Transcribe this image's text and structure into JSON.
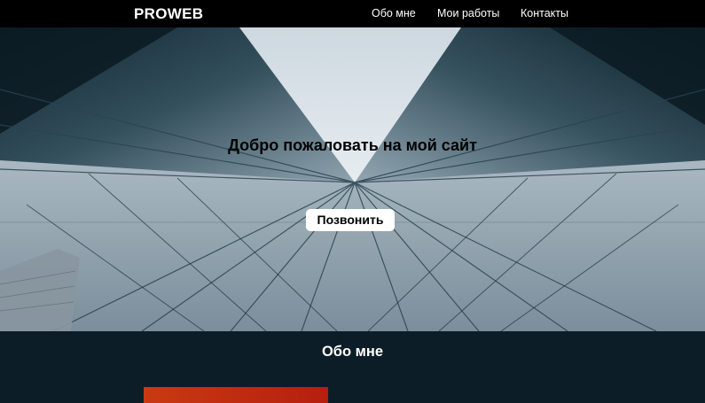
{
  "header": {
    "logo": "PROWEB",
    "nav": [
      {
        "label": "Обо мне"
      },
      {
        "label": "Мои работы"
      },
      {
        "label": "Контакты"
      }
    ]
  },
  "hero": {
    "title": "Добро пожаловать на мой сайт",
    "button_label": "Позвонить",
    "image": "low-angle-glass-skyscrapers-photo"
  },
  "about": {
    "title": "Обо мне"
  },
  "colors": {
    "header_bg": "#000000",
    "section_bg": "#0d1d27",
    "accent": "#c93a12",
    "button_bg": "#ffffff"
  }
}
